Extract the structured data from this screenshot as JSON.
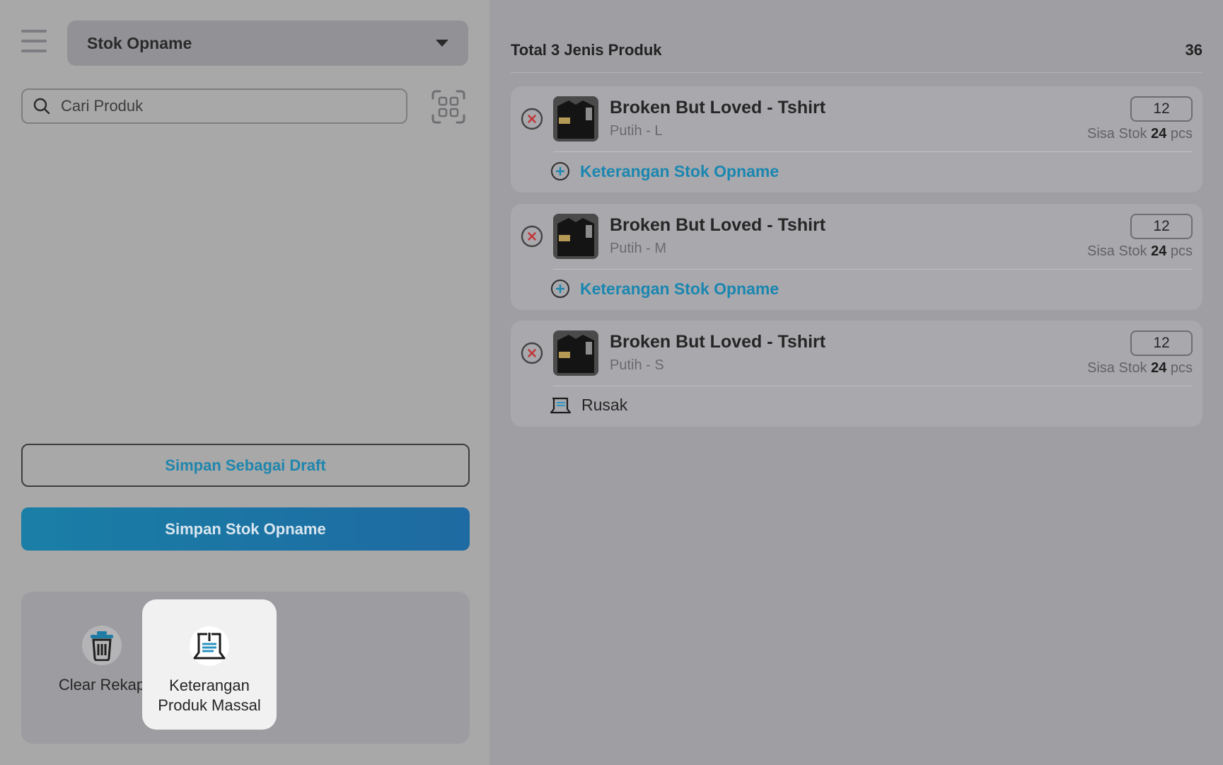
{
  "header": {
    "mode_label": "Stok Opname"
  },
  "search": {
    "placeholder": "Cari Produk"
  },
  "buttons": {
    "draft_label": "Simpan Sebagai Draft",
    "save_label": "Simpan Stok Opname"
  },
  "actions": [
    {
      "label": "Clear Rekap",
      "icon": "trash-icon"
    },
    {
      "label": "Keterangan Produk Massal",
      "icon": "bulk-note-icon"
    }
  ],
  "summary": {
    "total_label": "Total 3 Jenis Produk",
    "total_count": "36"
  },
  "items": [
    {
      "name": "Broken But Loved - Tshirt",
      "variant": "Putih - L",
      "qty": "12",
      "stock_prefix": "Sisa Stok",
      "stock_value": "24",
      "stock_unit": "pcs",
      "note_label": "Keterangan Stok Opname"
    },
    {
      "name": "Broken But Loved - Tshirt",
      "variant": "Putih - M",
      "qty": "12",
      "stock_prefix": "Sisa Stok",
      "stock_value": "24",
      "stock_unit": "pcs",
      "note_label": "Keterangan Stok Opname"
    },
    {
      "name": "Broken But Loved - Tshirt",
      "variant": "Putih - S",
      "qty": "12",
      "stock_prefix": "Sisa Stok",
      "stock_value": "24",
      "stock_unit": "pcs",
      "note_label": "Rusak"
    }
  ],
  "colors": {
    "accent": "#1a86b0",
    "primary_button": "#1a7fa6",
    "remove": "#c0393b"
  }
}
